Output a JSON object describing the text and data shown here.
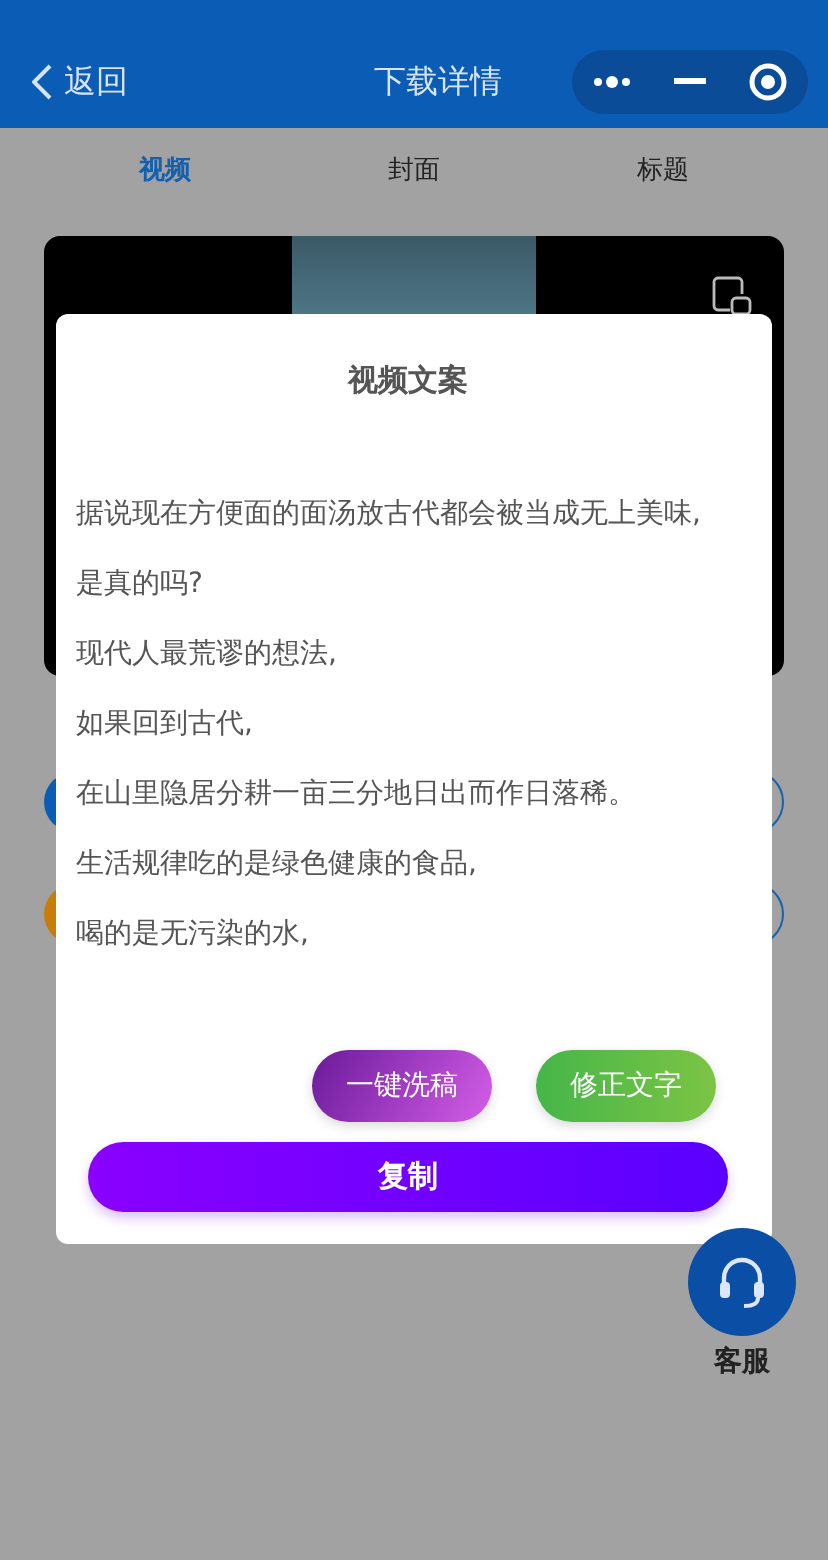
{
  "nav_bar": {
    "back_label": "返回",
    "title": "下载详情"
  },
  "tabs": [
    {
      "label": "视频",
      "selected": true
    },
    {
      "label": "封面",
      "selected": false
    },
    {
      "label": "标题",
      "selected": false
    }
  ],
  "background_rows": [
    {
      "color": "#0b5cb5"
    },
    {
      "color": "#c77d0a"
    }
  ],
  "dialog": {
    "title": "视频文案",
    "paragraphs": [
      "据说现在方便面的面汤放古代都会被当成无上美味,",
      "是真的吗?",
      "现代人最荒谬的想法,",
      "如果回到古代,",
      "在山里隐居分耕一亩三分地日出而作日落稀。",
      "生活规律吃的是绿色健康的食品,",
      "喝的是无污染的水,"
    ],
    "actions": [
      {
        "label": "一键洗稿",
        "kind": "rewrite"
      },
      {
        "label": "修正文字",
        "kind": "fix"
      }
    ],
    "primary": "复制"
  },
  "customer_service": {
    "label": "客服"
  }
}
